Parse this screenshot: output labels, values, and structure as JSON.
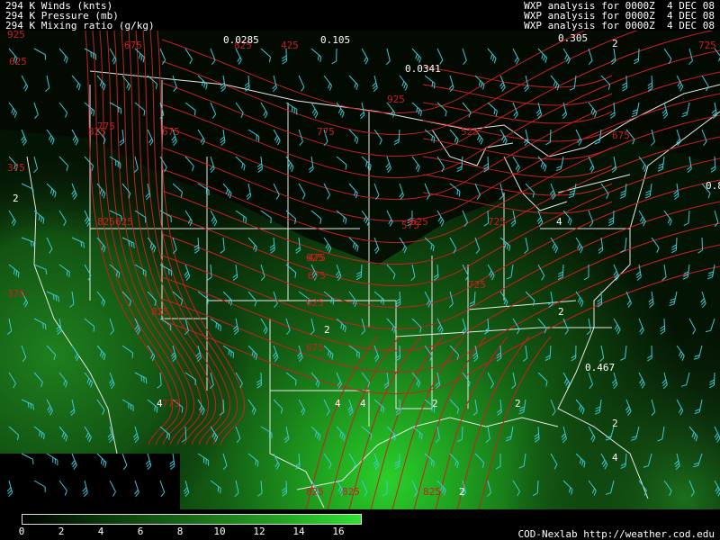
{
  "header": {
    "left_lines": [
      "294 K Winds (knts)",
      "294 K Pressure (mb)",
      "294 K Mixing ratio (g/kg)"
    ],
    "right_lines": [
      "WXP analysis for 0000Z  4 DEC 08",
      "WXP analysis for 0000Z  4 DEC 08",
      "WXP analysis for 0000Z  4 DEC 08"
    ]
  },
  "colors": {
    "background": "#000000",
    "pressure_contour": "#c82020",
    "wind_barb": "#40c8d8",
    "border": "#e8e8e8",
    "mixing_low": "#000000",
    "mixing_high": "#30e030"
  },
  "map_labels": {
    "pressure": [
      "675",
      "775",
      "625",
      "825",
      "425",
      "675",
      "375",
      "625",
      "525",
      "775",
      "825",
      "625",
      "475",
      "375",
      "675",
      "825",
      "625",
      "675",
      "575",
      "725",
      "725",
      "625",
      "675",
      "725",
      "775",
      "825",
      "825",
      "825",
      "825",
      "925",
      "925"
    ],
    "mixing": [
      "0.0285",
      "0.105",
      "0.0341",
      "0.305",
      "2",
      "2",
      "4",
      "2",
      "4",
      "2",
      "0.467",
      "4",
      "2",
      "2",
      "4",
      "2",
      "4",
      "2",
      "0.8"
    ]
  },
  "colorbar": {
    "ticks": [
      "0",
      "2",
      "4",
      "6",
      "8",
      "10",
      "12",
      "14",
      "16"
    ]
  },
  "credit": "COD-Nexlab http://weather.cod.edu"
}
